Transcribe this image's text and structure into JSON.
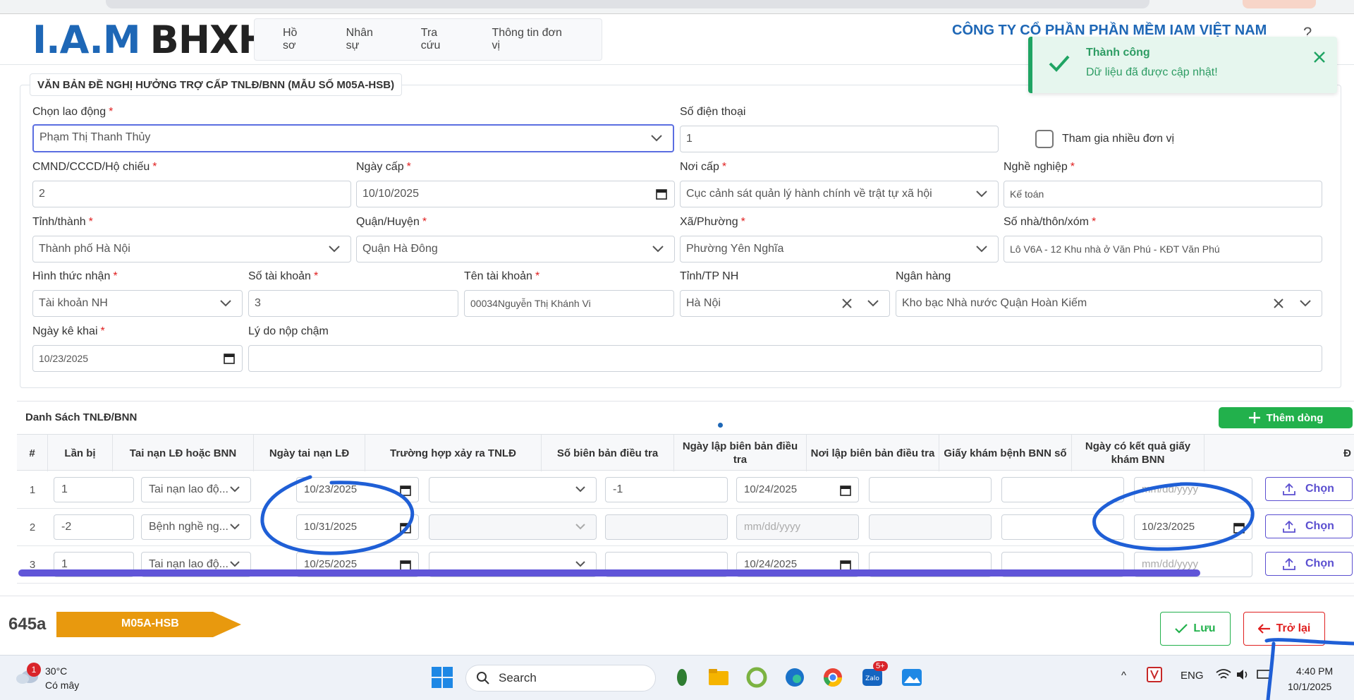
{
  "header": {
    "logo_part1": "I.A.M",
    "logo_part2": "BHXH",
    "nav": [
      "Hồ sơ",
      "Nhân sự",
      "Tra cứu",
      "Thông tin đơn vị"
    ],
    "company": "CÔNG TY CỔ PHẦN PHẦN MỀM IAM VIỆT NAM"
  },
  "toast": {
    "title": "Thành công",
    "message": "Dữ liệu đã được cập nhật!",
    "color": "#1fa463"
  },
  "form": {
    "legend": "VĂN BẢN ĐỀ NGHỊ HƯỞNG TRỢ CẤP TNLĐ/BNN (MẪU SỐ M05A-HSB)",
    "required_mark": "*",
    "chon_lao_dong": {
      "label": "Chọn lao động",
      "value": "Phạm Thị Thanh Thủy"
    },
    "so_dien_thoai": {
      "label": "Số điện thoại",
      "value": "1"
    },
    "tham_gia": {
      "label": "Tham gia nhiều đơn vị",
      "checked": false
    },
    "cmnd": {
      "label": "CMND/CCCD/Hộ chiếu",
      "value": "2"
    },
    "ngay_cap": {
      "label": "Ngày cấp",
      "value": "10/10/2025"
    },
    "noi_cap": {
      "label": "Nơi cấp",
      "value": "Cục cảnh sát quản lý hành chính về trật tự xã hội"
    },
    "nghe_nghiep": {
      "label": "Nghề nghiệp",
      "value": "Kế toán"
    },
    "tinh_thanh": {
      "label": "Tỉnh/thành",
      "value": "Thành phố Hà Nội"
    },
    "quan_huyen": {
      "label": "Quận/Huyện",
      "value": "Quận Hà Đông"
    },
    "xa_phuong": {
      "label": "Xã/Phường",
      "value": "Phường Yên Nghĩa"
    },
    "so_nha": {
      "label": "Số nhà/thôn/xóm",
      "value": "Lô V6A - 12 Khu nhà ở Văn Phú - KĐT Văn Phú"
    },
    "hinh_thuc_nhan": {
      "label": "Hình thức nhận",
      "value": "Tài khoản NH"
    },
    "so_tai_khoan": {
      "label": "Số tài khoản",
      "value": "3"
    },
    "ten_tai_khoan": {
      "label": "Tên tài khoản",
      "value": "00034Nguyễn Thị Khánh Vi"
    },
    "tinh_tp_nh": {
      "label": "Tỉnh/TP NH",
      "value": "Hà Nội"
    },
    "ngan_hang": {
      "label": "Ngân hàng",
      "value": "Kho bạc Nhà nước Quận Hoàn Kiếm"
    },
    "ngay_ke_khai": {
      "label": "Ngày kê khai",
      "value": "10/23/2025"
    },
    "ly_do": {
      "label": "Lý do nộp chậm",
      "value": ""
    }
  },
  "table": {
    "title": "Danh Sách TNLĐ/BNN",
    "add_button": "Thêm dòng",
    "columns": [
      "#",
      "Lần bị",
      "Tai nạn LĐ hoặc BNN",
      "Ngày tai nạn LĐ",
      "Trường hợp xảy ra TNLĐ",
      "Số biên bản điều tra",
      "Ngày lập biên bản điều tra",
      "Nơi lập biên bản điều tra",
      "Giấy khám bệnh BNN số",
      "Ngày có kết quả giấy khám BNN",
      "Đ"
    ],
    "upload_label": "Chọn",
    "date_placeholder": "mm/dd/yyyy",
    "rows": [
      {
        "num": "1",
        "lan_bi": "1",
        "loai": "Tai nạn lao độ...",
        "ngay_tai_nan": "10/23/2025",
        "truong_hop": "",
        "so_bien_ban": "-1",
        "ngay_lap": "10/24/2025",
        "noi_lap": "",
        "giay_kham": "",
        "ngay_ket_qua": "mm/dd/yyyy"
      },
      {
        "num": "2",
        "lan_bi": "-2",
        "loai": "Bệnh nghề ng...",
        "ngay_tai_nan": "10/31/2025",
        "truong_hop": "",
        "so_bien_ban": "",
        "ngay_lap": "mm/dd/yyyy",
        "noi_lap": "",
        "giay_kham": "",
        "ngay_ket_qua": "10/23/2025"
      },
      {
        "num": "3",
        "lan_bi": "1",
        "loai": "Tai nạn lao độ...",
        "ngay_tai_nan": "10/25/2025",
        "truong_hop": "",
        "so_bien_ban": "",
        "ngay_lap": "10/24/2025",
        "noi_lap": "",
        "giay_kham": "",
        "ngay_ket_qua": "mm/dd/yyyy"
      }
    ]
  },
  "footer": {
    "code": "645a",
    "form_tag": "M05A-HSB",
    "save": "Lưu",
    "back": "Trở lại"
  },
  "taskbar": {
    "badge": "1",
    "temperature": "30°C",
    "condition": "Có mây",
    "search": "Search",
    "lang": "ENG",
    "time": "4:40 PM",
    "date": "10/1/2025",
    "zalo_badge": "5+"
  },
  "colors": {
    "primary": "#1e67b6",
    "success": "#22b14c",
    "danger": "#e02020",
    "accent": "#5b4fd0",
    "tag": "#e8990e"
  }
}
